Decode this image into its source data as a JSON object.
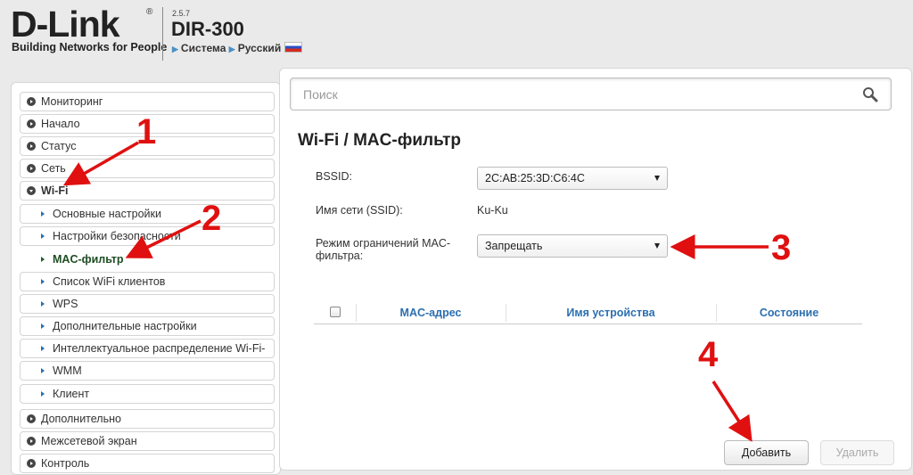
{
  "header": {
    "logo": "D-Link",
    "logo_reg": "®",
    "slogan": "Building Networks for People",
    "version": "2.5.7",
    "model": "DIR-300",
    "crumb_system": "Система",
    "crumb_language": "Русский"
  },
  "sidebar": {
    "items": [
      {
        "label": "Мониторинг"
      },
      {
        "label": "Начало"
      },
      {
        "label": "Статус"
      },
      {
        "label": "Сеть"
      },
      {
        "label": "Wi-Fi"
      },
      {
        "label": "Дополнительно"
      },
      {
        "label": "Межсетевой экран"
      },
      {
        "label": "Контроль"
      }
    ],
    "wifi_sub": [
      {
        "label": "Основные настройки"
      },
      {
        "label": "Настройки безопасности"
      },
      {
        "label": "MAC-фильтр"
      },
      {
        "label": "Список WiFi клиентов"
      },
      {
        "label": "WPS"
      },
      {
        "label": "Дополнительные настройки"
      },
      {
        "label": "Интеллектуальное распределение Wi-Fi-"
      },
      {
        "label": "WMM"
      },
      {
        "label": "Клиент"
      }
    ]
  },
  "search": {
    "placeholder": "Поиск"
  },
  "page": {
    "title": "Wi-Fi /  MAC-фильтр"
  },
  "form": {
    "bssid_label": "BSSID:",
    "bssid_value": "2C:AB:25:3D:C6:4C",
    "ssid_label": "Имя сети (SSID):",
    "ssid_value": "Ku-Ku",
    "mode_label_1": "Режим ограничений MAC-",
    "mode_label_2": "фильтра:",
    "mode_value": "Запрещать"
  },
  "table": {
    "headers": [
      "MAC-адрес",
      "Имя устройства",
      "Состояние"
    ]
  },
  "buttons": {
    "add": "Добавить",
    "delete": "Удалить"
  },
  "annotations": {
    "n1": "1",
    "n2": "2",
    "n3": "3",
    "n4": "4"
  },
  "colors": {
    "accent": "#2b6fb0",
    "annotation": "#e01010",
    "active": "#1d4d22"
  }
}
